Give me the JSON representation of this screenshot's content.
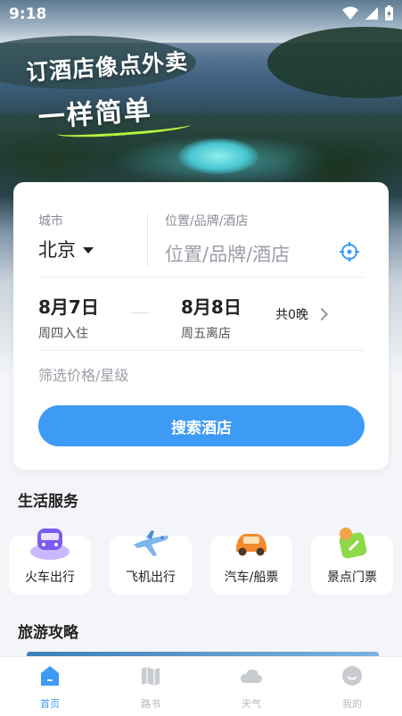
{
  "status_bar": {
    "time": "9:18"
  },
  "hero": {
    "slogan_line1": "订酒店像点外卖",
    "slogan_line2": "一样简单"
  },
  "search": {
    "city_label": "城市",
    "city_value": "北京",
    "location_label": "位置/品牌/酒店",
    "location_placeholder": "位置/品牌/酒店",
    "checkin_date": "8月7日",
    "checkin_sub": "周四入住",
    "checkout_date": "8月8日",
    "checkout_sub": "周五离店",
    "nights": "共0晚",
    "filter_placeholder": "筛选价格/星级",
    "search_button": "搜索酒店"
  },
  "life_services": {
    "title": "生活服务",
    "items": [
      {
        "label": "火车出行",
        "icon": "train-icon"
      },
      {
        "label": "飞机出行",
        "icon": "plane-icon"
      },
      {
        "label": "汽车/船票",
        "icon": "car-icon"
      },
      {
        "label": "景点门票",
        "icon": "ticket-icon"
      }
    ]
  },
  "travel_guides": {
    "title": "旅游攻略"
  },
  "bottom_nav": {
    "items": [
      {
        "label": "首页",
        "icon": "home-icon",
        "active": true
      },
      {
        "label": "路书",
        "icon": "map-icon",
        "active": false
      },
      {
        "label": "天气",
        "icon": "cloud-icon",
        "active": false
      },
      {
        "label": "我的",
        "icon": "profile-icon",
        "active": false
      }
    ]
  },
  "colors": {
    "accent": "#3d9bf5",
    "inactive": "#b5b8bd"
  }
}
